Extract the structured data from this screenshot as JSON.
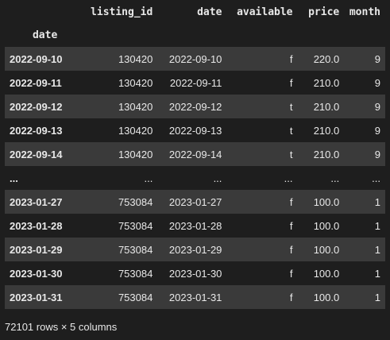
{
  "table": {
    "columns": [
      "listing_id",
      "date",
      "available",
      "price",
      "month"
    ],
    "index_name": "date",
    "rows": [
      {
        "index": "2022-09-10",
        "cells": [
          "130420",
          "2022-09-10",
          "f",
          "220.0",
          "9"
        ]
      },
      {
        "index": "2022-09-11",
        "cells": [
          "130420",
          "2022-09-11",
          "f",
          "210.0",
          "9"
        ]
      },
      {
        "index": "2022-09-12",
        "cells": [
          "130420",
          "2022-09-12",
          "t",
          "210.0",
          "9"
        ]
      },
      {
        "index": "2022-09-13",
        "cells": [
          "130420",
          "2022-09-13",
          "t",
          "210.0",
          "9"
        ]
      },
      {
        "index": "2022-09-14",
        "cells": [
          "130420",
          "2022-09-14",
          "t",
          "210.0",
          "9"
        ]
      },
      {
        "index": "...",
        "cells": [
          "...",
          "...",
          "...",
          "...",
          "..."
        ]
      },
      {
        "index": "2023-01-27",
        "cells": [
          "753084",
          "2023-01-27",
          "f",
          "100.0",
          "1"
        ]
      },
      {
        "index": "2023-01-28",
        "cells": [
          "753084",
          "2023-01-28",
          "f",
          "100.0",
          "1"
        ]
      },
      {
        "index": "2023-01-29",
        "cells": [
          "753084",
          "2023-01-29",
          "f",
          "100.0",
          "1"
        ]
      },
      {
        "index": "2023-01-30",
        "cells": [
          "753084",
          "2023-01-30",
          "f",
          "100.0",
          "1"
        ]
      },
      {
        "index": "2023-01-31",
        "cells": [
          "753084",
          "2023-01-31",
          "f",
          "100.0",
          "1"
        ]
      }
    ]
  },
  "footer": "72101 rows × 5 columns",
  "colors": {
    "background": "#1e1e1e",
    "shaded_row": "#3a3a3a",
    "text": "#e8e8e8"
  }
}
